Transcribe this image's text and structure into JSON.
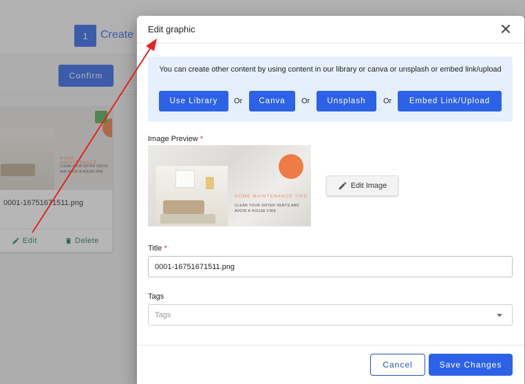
{
  "background": {
    "step_number": "1",
    "step_label": "Create",
    "confirm_label": "Confirm",
    "card": {
      "filename": "0001-16751671511.png",
      "edit_label": "Edit",
      "delete_label": "Delete",
      "thumb_text_1": "HOME MAINTENANCE",
      "thumb_text_2": "CLEAN YOUR DRYER VENTS AND AVOID A HOUSE FIRE"
    }
  },
  "dialog": {
    "title": "Edit graphic",
    "info_text": "You can create other content by using content in our library or canva or unsplash or embed link/upload",
    "sources": {
      "library": "Use Library",
      "canva": "Canva",
      "unsplash": "Unsplash",
      "embed": "Embed Link/Upload",
      "or": "Or"
    },
    "image_preview_label": "Image Preview",
    "required_mark": "*",
    "preview": {
      "circle_line_1": "",
      "headline": "HOME MAINTENANCE TIPS",
      "subtext": "CLEAN YOUR DRYER VENTS AND AVOID A HOUSE FIRE"
    },
    "edit_image_label": "Edit Image",
    "title_label": "Title",
    "title_value": "0001-16751671511.png",
    "tags_label": "Tags",
    "tags_placeholder": "Tags",
    "cancel_label": "Cancel",
    "save_label": "Save Changes"
  },
  "colors": {
    "primary": "#2d62e8",
    "annotation_arrow": "#e8201f",
    "required": "#d32f2f",
    "info_bg": "#e6f0fd"
  }
}
